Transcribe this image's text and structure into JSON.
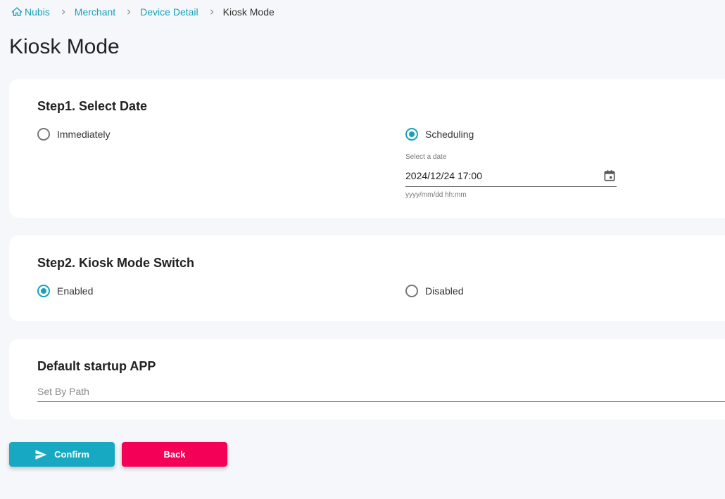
{
  "breadcrumb": {
    "items": [
      "Nubis",
      "Merchant",
      "Device Detail"
    ],
    "current": "Kiosk Mode"
  },
  "page_title": "Kiosk Mode",
  "step1": {
    "title": "Step1. Select Date",
    "option_immediately": "Immediately",
    "option_scheduling": "Scheduling",
    "selected": "Scheduling",
    "date_label": "Select a date",
    "date_value": "2024/12/24 17:00",
    "date_hint": "yyyy/mm/dd hh:mm"
  },
  "step2": {
    "title": "Step2. Kiosk Mode Switch",
    "option_enabled": "Enabled",
    "option_disabled": "Disabled",
    "selected": "Enabled"
  },
  "startup": {
    "title": "Default startup APP",
    "placeholder": "Set By Path",
    "value": ""
  },
  "buttons": {
    "confirm": "Confirm",
    "back": "Back"
  },
  "colors": {
    "accent": "#17a2b8",
    "confirm": "#17a9c1",
    "back": "#f50057"
  },
  "icons": {
    "home": "home-icon",
    "separator": "chevron-right-icon",
    "calendar": "calendar-icon",
    "confirm": "send-icon"
  }
}
